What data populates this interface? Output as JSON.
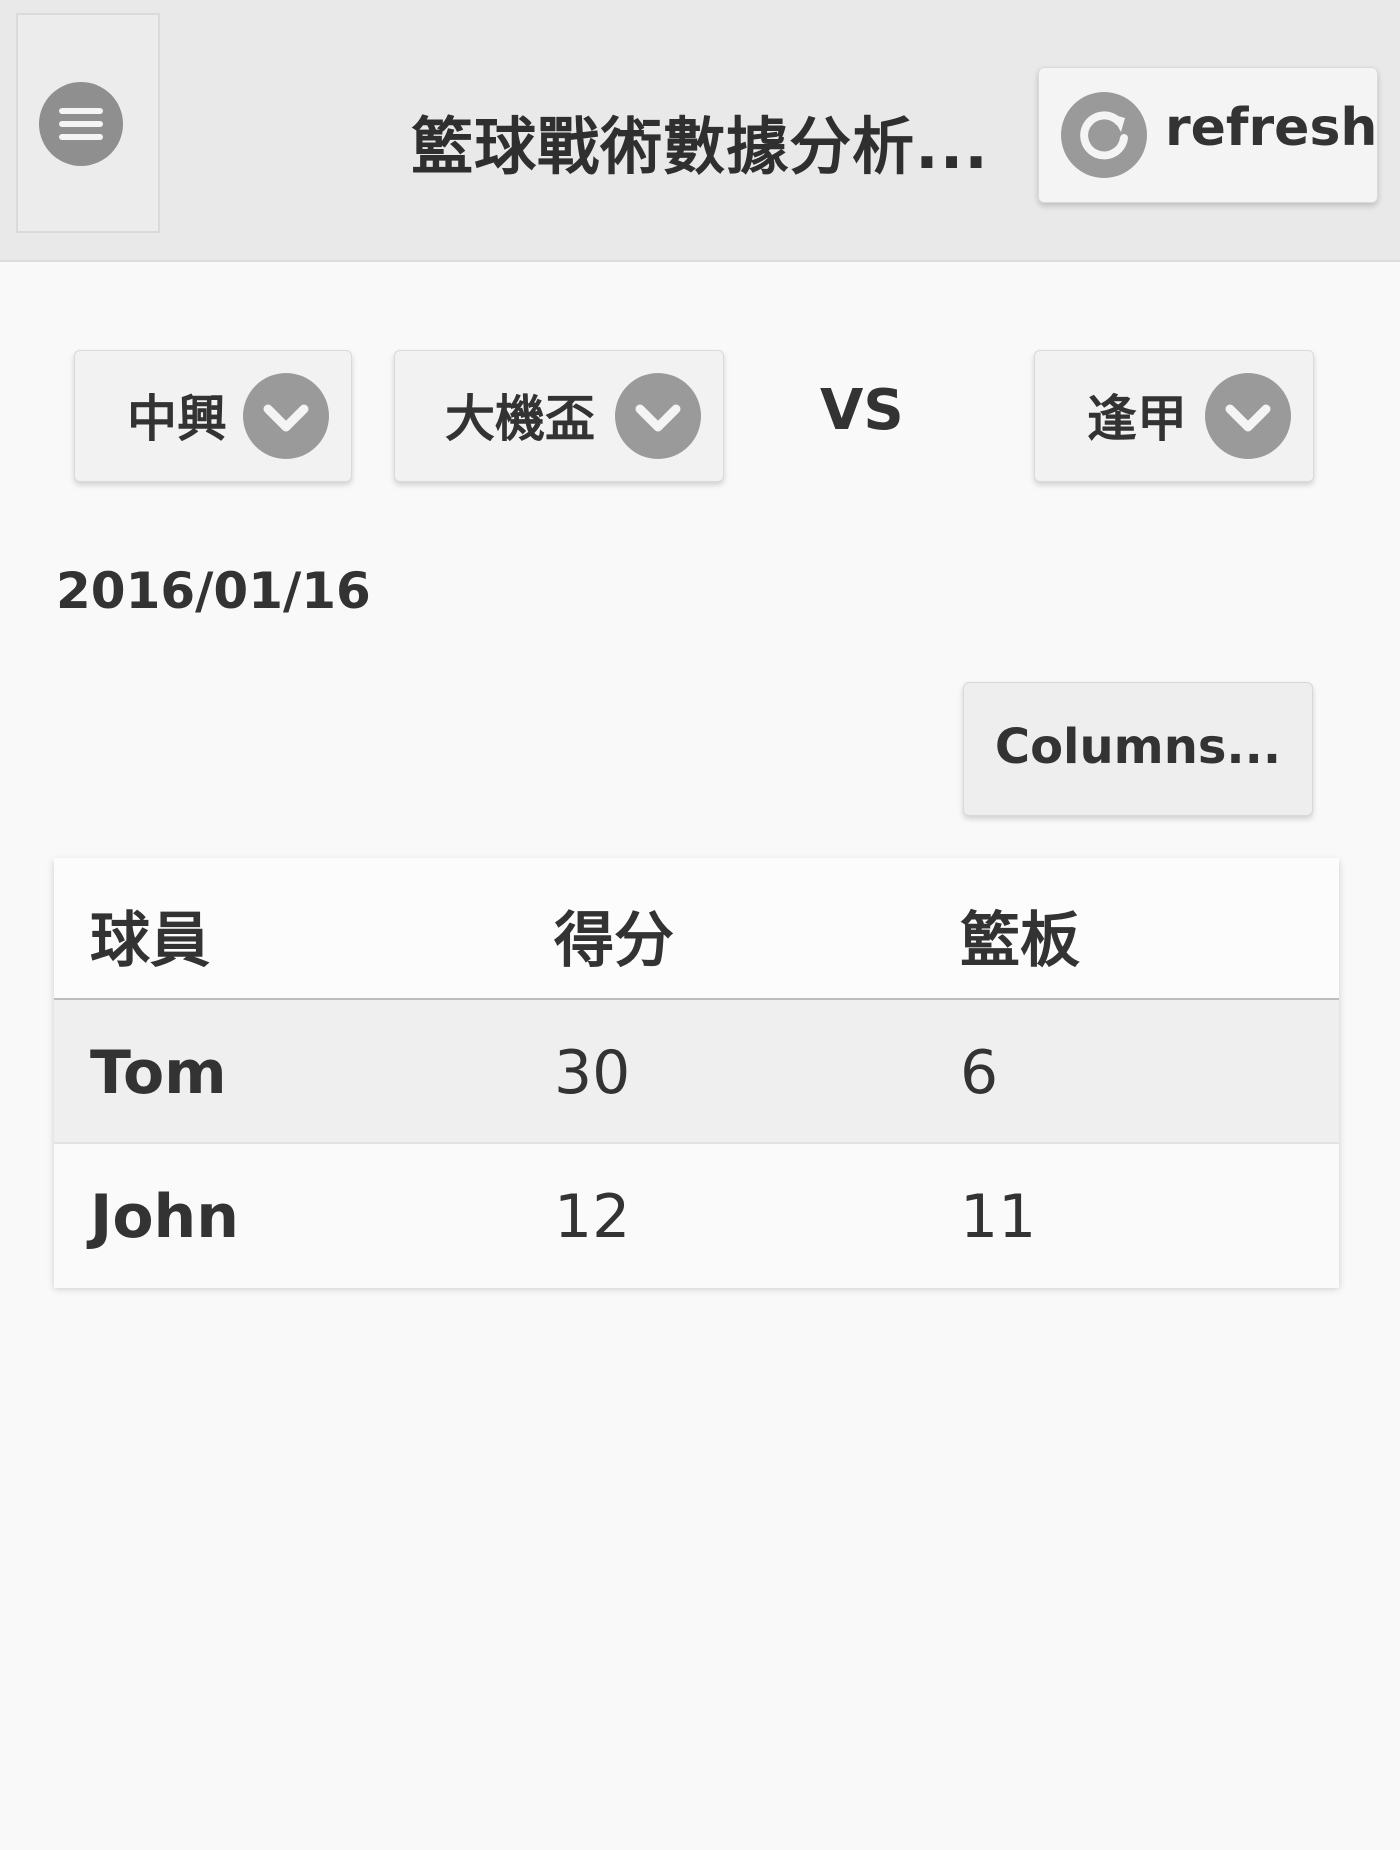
{
  "header": {
    "title": "籃球戰術數據分析...",
    "refresh_label": "refresh",
    "menu_icon": "menu-icon",
    "refresh_icon": "refresh-icon"
  },
  "selectors": {
    "school": "中興",
    "tournament": "大機盃",
    "vs_label": "VS",
    "opponent": "逢甲"
  },
  "date": "2016/01/16",
  "columns_button": "Columns...",
  "table": {
    "headers": [
      "球員",
      "得分",
      "籃板"
    ],
    "rows": [
      [
        "Tom",
        "30",
        "6"
      ],
      [
        "John",
        "12",
        "11"
      ]
    ]
  },
  "colors": {
    "header_bg": "#e9e9e9",
    "icon_gray": "#9a9a9a",
    "page_bg": "#f9f9f9"
  }
}
